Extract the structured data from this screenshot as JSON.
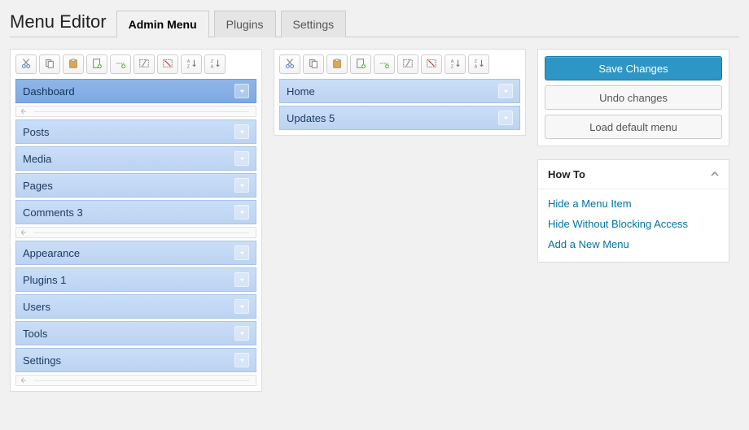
{
  "header": {
    "title": "Menu Editor",
    "tabs": [
      "Admin Menu",
      "Plugins",
      "Settings"
    ],
    "active_tab": 0
  },
  "toolbar_icons": [
    "cut",
    "copy",
    "paste",
    "new",
    "new-sep",
    "show",
    "hide",
    "sort-az",
    "sort-za"
  ],
  "main_menu": {
    "selected_index": 0,
    "rows": [
      {
        "type": "item",
        "label": "Dashboard"
      },
      {
        "type": "sep"
      },
      {
        "type": "item",
        "label": "Posts"
      },
      {
        "type": "item",
        "label": "Media"
      },
      {
        "type": "item",
        "label": "Pages"
      },
      {
        "type": "item",
        "label": "Comments 3"
      },
      {
        "type": "sep"
      },
      {
        "type": "item",
        "label": "Appearance"
      },
      {
        "type": "item",
        "label": "Plugins 1"
      },
      {
        "type": "item",
        "label": "Users"
      },
      {
        "type": "item",
        "label": "Tools"
      },
      {
        "type": "item",
        "label": "Settings"
      },
      {
        "type": "sep"
      }
    ]
  },
  "sub_menu": {
    "rows": [
      {
        "type": "item",
        "label": "Home"
      },
      {
        "type": "item",
        "label": "Updates 5"
      }
    ]
  },
  "actions": {
    "save": "Save Changes",
    "undo": "Undo changes",
    "load_default": "Load default menu"
  },
  "howto": {
    "title": "How To",
    "links": [
      "Hide a Menu Item",
      "Hide Without Blocking Access",
      "Add a New Menu"
    ]
  }
}
